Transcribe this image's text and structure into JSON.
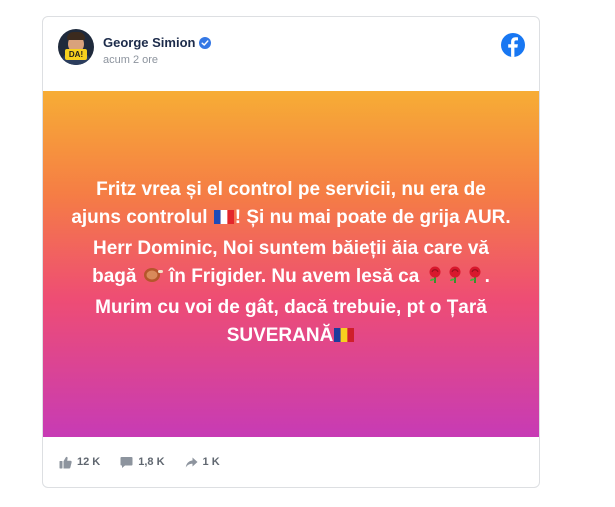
{
  "post": {
    "author": "George Simion",
    "timestamp": "acum 2 ore",
    "avatar_badge_text": "DA!",
    "verified_icon": "verified-badge-icon",
    "platform_icon": "facebook-logo-icon",
    "text": {
      "line1_a": "Fritz vrea și el control pe servicii, nu era de ajuns controlul ",
      "line1_b": "! Și nu mai poate de grija AUR.",
      "line2_a": "Herr Dominic, Noi suntem băieții ăia care vă bagă ",
      "line2_b": " în Frigider. Nu avem lesă ca ",
      "line2_c": ". Murim cu voi de gât, dacă trebuie, pt o Țară SUVERANĂ"
    },
    "emojis": [
      "flag-france-icon",
      "meat-icon",
      "rose-icon",
      "rose-icon",
      "rose-icon",
      "flag-romania-icon"
    ],
    "background_gradient": [
      "#f7ad35",
      "#f57d45",
      "#ee4d74",
      "#c73bb5"
    ]
  },
  "stats": {
    "likes": "12 K",
    "comments": "1,8 K",
    "shares": "1 K"
  },
  "colors": {
    "facebook_blue": "#1877f2",
    "verified_blue": "#3578e5",
    "author_name": "#1c2b4a",
    "meta_gray": "#8d949e"
  }
}
